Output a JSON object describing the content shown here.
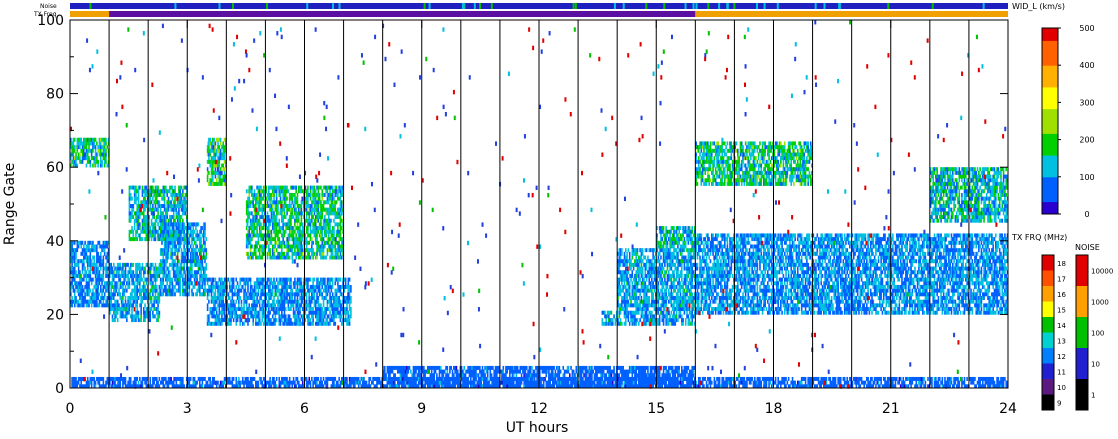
{
  "chart_data": {
    "type": "heatmap",
    "xlabel": "UT hours",
    "ylabel": "Range Gate",
    "xlim": [
      0,
      24
    ],
    "ylim": [
      0,
      100
    ],
    "x_ticks": [
      "0",
      "3",
      "6",
      "9",
      "12",
      "15",
      "18",
      "21",
      "24"
    ],
    "y_ticks": [
      "0",
      "20",
      "40",
      "60",
      "80",
      "100"
    ],
    "vertical_lines_ut": [
      1,
      2,
      3,
      4,
      5,
      6,
      7,
      8,
      9,
      10,
      11,
      12,
      13,
      14,
      15,
      16,
      17,
      18,
      19,
      20,
      21,
      22,
      23
    ],
    "top_bars": {
      "noise_label": "Noise",
      "txfreq_label": "TX Freq",
      "noise_color": "#2020c0",
      "txfreq_segments": [
        {
          "from": 0,
          "to": 1,
          "color": "#f0a000"
        },
        {
          "from": 1,
          "to": 16,
          "color": "#5a10a0"
        },
        {
          "from": 16,
          "to": 24,
          "color": "#f0a000"
        }
      ]
    },
    "echo_regions": [
      {
        "x0": 0.0,
        "x1": 1.0,
        "g0": 22,
        "g1": 40,
        "level": 0.2
      },
      {
        "x0": 0.0,
        "x1": 1.0,
        "g0": 60,
        "g1": 68,
        "level": 0.35
      },
      {
        "x0": 1.0,
        "x1": 2.3,
        "g0": 18,
        "g1": 34,
        "level": 0.25
      },
      {
        "x0": 1.5,
        "x1": 3.0,
        "g0": 40,
        "g1": 55,
        "level": 0.3
      },
      {
        "x0": 2.3,
        "x1": 3.5,
        "g0": 25,
        "g1": 45,
        "level": 0.25
      },
      {
        "x0": 3.5,
        "x1": 4.0,
        "g0": 55,
        "g1": 68,
        "level": 0.4
      },
      {
        "x0": 3.5,
        "x1": 7.2,
        "g0": 17,
        "g1": 30,
        "level": 0.22
      },
      {
        "x0": 4.5,
        "x1": 7.0,
        "g0": 35,
        "g1": 55,
        "level": 0.35
      },
      {
        "x0": 13.6,
        "x1": 14.0,
        "g0": 17,
        "g1": 21,
        "level": 0.25
      },
      {
        "x0": 14.0,
        "x1": 16.0,
        "g0": 17,
        "g1": 38,
        "level": 0.25
      },
      {
        "x0": 15.0,
        "x1": 16.0,
        "g0": 38,
        "g1": 44,
        "level": 0.3
      },
      {
        "x0": 16.0,
        "x1": 24.0,
        "g0": 20,
        "g1": 42,
        "level": 0.22
      },
      {
        "x0": 16.0,
        "x1": 19.0,
        "g0": 55,
        "g1": 67,
        "level": 0.35
      },
      {
        "x0": 22.0,
        "x1": 24.0,
        "g0": 45,
        "g1": 60,
        "level": 0.3
      },
      {
        "x0": 8.0,
        "x1": 16.0,
        "g0": 0,
        "g1": 6,
        "level": 0.15
      },
      {
        "x0": 0.0,
        "x1": 24.0,
        "g0": 0,
        "g1": 3,
        "level": 0.15
      }
    ]
  },
  "colorbars": {
    "width": {
      "label": "WID_L (km/s)",
      "ticks": [
        "0",
        "100",
        "200",
        "300",
        "400",
        "500"
      ],
      "stops": [
        "#2a00d0",
        "#0060ff",
        "#00c0e0",
        "#00d000",
        "#a0e000",
        "#ffff00",
        "#ffb000",
        "#ff6000",
        "#e00000"
      ]
    },
    "txfreq": {
      "label": "TX FRQ (MHz)",
      "ticks": [
        "9",
        "10",
        "11",
        "12",
        "13",
        "14",
        "15",
        "16",
        "17",
        "18"
      ],
      "colors": [
        "#000000",
        "#5a1a80",
        "#2020d0",
        "#0080ff",
        "#00d0d0",
        "#00c000",
        "#ffff00",
        "#ffa000",
        "#ff5000",
        "#e00000"
      ]
    },
    "noise": {
      "label": "NOISE",
      "ticks": [
        "1",
        "10",
        "100",
        "1000",
        "10000"
      ],
      "colors": [
        "#000000",
        "#2020d0",
        "#00c000",
        "#ffa000",
        "#e00000"
      ]
    }
  }
}
